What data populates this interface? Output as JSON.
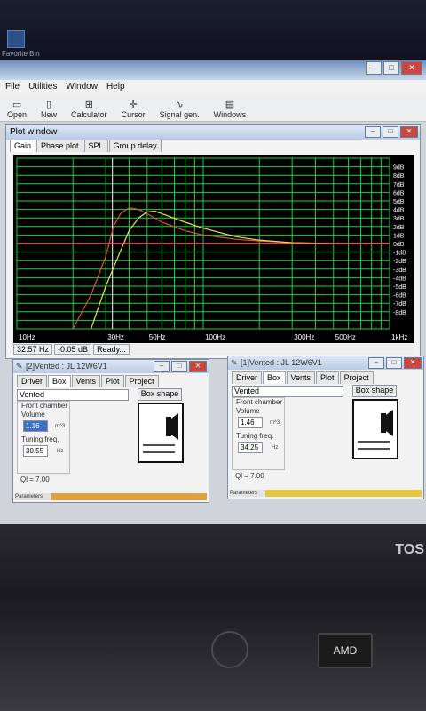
{
  "desktop": {
    "label": "Favorite Bin"
  },
  "menubar": [
    "File",
    "Utilities",
    "Window",
    "Help"
  ],
  "toolbar": [
    "Open",
    "New",
    "Calculator",
    "Cursor",
    "Signal gen.",
    "Windows"
  ],
  "plot_window": {
    "title": "Plot window",
    "tabs": [
      "Gain",
      "Phase plot",
      "SPL",
      "Group delay"
    ],
    "status": {
      "freq": "32.57 Hz",
      "gain": "-0.05 dB",
      "state": "Ready..."
    }
  },
  "chart_data": {
    "type": "line",
    "xscale": "log",
    "xlim": [
      10,
      1000
    ],
    "ylim": [
      -10,
      10
    ],
    "x_ticks": [
      "10Hz",
      "30Hz",
      "50Hz",
      "100Hz",
      "300Hz",
      "500Hz",
      "1kHz"
    ],
    "y_ticks": [
      "9dB",
      "8dB",
      "7dB",
      "6dB",
      "5dB",
      "4dB",
      "3dB",
      "2dB",
      "1dB",
      "0dB",
      "-1dB",
      "-2dB",
      "-3dB",
      "-4dB",
      "-5dB",
      "-6dB",
      "-7dB",
      "-8dB"
    ],
    "grid": true,
    "cursor_x": 32.57,
    "series": [
      {
        "color": "#e0523c",
        "x": [
          20,
          25,
          30,
          33,
          36,
          40,
          45,
          50,
          60,
          80,
          100,
          150,
          200,
          300,
          500,
          1000
        ],
        "y": [
          -10,
          -6,
          -1.5,
          2,
          3.5,
          4.2,
          4.0,
          3.5,
          2.5,
          1.5,
          1.0,
          0.5,
          0.3,
          0.1,
          0,
          0
        ]
      },
      {
        "color": "#e8e050",
        "x": [
          25,
          30,
          35,
          40,
          45,
          50,
          55,
          60,
          80,
          100,
          150,
          200,
          300,
          500,
          1000
        ],
        "y": [
          -10,
          -5,
          -1.5,
          1.5,
          3.0,
          3.7,
          3.8,
          3.5,
          2.5,
          1.8,
          0.8,
          0.4,
          0.1,
          0,
          0
        ]
      },
      {
        "color": "#ff6060",
        "x": [
          10,
          1000
        ],
        "y": [
          0,
          0
        ]
      }
    ]
  },
  "sub_left": {
    "title": "[2]Vented : JL 12W6V1",
    "tabs": [
      "Driver",
      "Box",
      "Vents",
      "Plot",
      "Project"
    ],
    "box_type": "Vented",
    "box_shape_btn": "Box shape",
    "front_chamber": "Front chamber",
    "volume_label": "Volume",
    "volume": "1.16",
    "volume_unit": "m^3",
    "tuning_label": "Tuning freq.",
    "tuning": "30.55",
    "tuning_unit": "Hz",
    "ql": "Ql = 7.00",
    "param": "Parameters"
  },
  "sub_right": {
    "title": "[1]Vented : JL 12W6V1",
    "tabs": [
      "Driver",
      "Box",
      "Vents",
      "Plot",
      "Project"
    ],
    "box_type": "Vented",
    "box_shape_btn": "Box shape",
    "front_chamber": "Front chamber",
    "volume_label": "Volume",
    "volume": "1.46",
    "volume_unit": "m^3",
    "tuning_label": "Tuning freq.",
    "tuning": "34.25",
    "tuning_unit": "Hz",
    "ql": "Ql = 7.00",
    "param": "Parameters"
  },
  "laptop": {
    "brand": "TOS",
    "badge": "AMD"
  },
  "colors": {
    "grid": "#1fcf3a",
    "bg": "#000000",
    "orange_bar": "#e0a040",
    "yellow_bar": "#e5c840"
  }
}
